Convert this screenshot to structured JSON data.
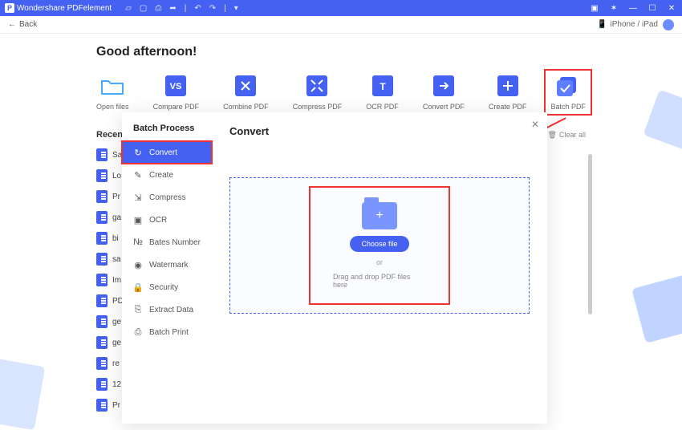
{
  "titlebar": {
    "app_name": "Wondershare PDFelement"
  },
  "subbar": {
    "back": "Back",
    "device": "iPhone / iPad"
  },
  "greeting": "Good afternoon!",
  "actions": [
    {
      "label": "Open files"
    },
    {
      "label": "Compare PDF"
    },
    {
      "label": "Combine PDF"
    },
    {
      "label": "Compress PDF"
    },
    {
      "label": "OCR PDF"
    },
    {
      "label": "Convert PDF"
    },
    {
      "label": "Create PDF"
    },
    {
      "label": "Batch PDF"
    }
  ],
  "recent": {
    "header": "Recent",
    "clear": "Clear all",
    "items": [
      {
        "name": "Sa"
      },
      {
        "name": "Lo"
      },
      {
        "name": "Pr"
      },
      {
        "name": "ga"
      },
      {
        "name": "bi"
      },
      {
        "name": "sa"
      },
      {
        "name": "Im"
      },
      {
        "name": "PD"
      },
      {
        "name": "ge"
      },
      {
        "name": "ge"
      },
      {
        "name": "re"
      },
      {
        "name": "12"
      },
      {
        "name": "Pr"
      }
    ]
  },
  "modal": {
    "title": "Batch Process",
    "close": "✕",
    "side_items": [
      {
        "label": "Convert",
        "icon": "↻"
      },
      {
        "label": "Create",
        "icon": "✎"
      },
      {
        "label": "Compress",
        "icon": "⇲"
      },
      {
        "label": "OCR",
        "icon": "▣"
      },
      {
        "label": "Bates Number",
        "icon": "№"
      },
      {
        "label": "Watermark",
        "icon": "◉"
      },
      {
        "label": "Security",
        "icon": "🔒"
      },
      {
        "label": "Extract Data",
        "icon": "⎘"
      },
      {
        "label": "Batch Print",
        "icon": "⎙"
      }
    ],
    "panel": {
      "title": "Convert",
      "choose": "Choose file",
      "or": "or",
      "dnd": "Drag and drop PDF files here"
    }
  }
}
